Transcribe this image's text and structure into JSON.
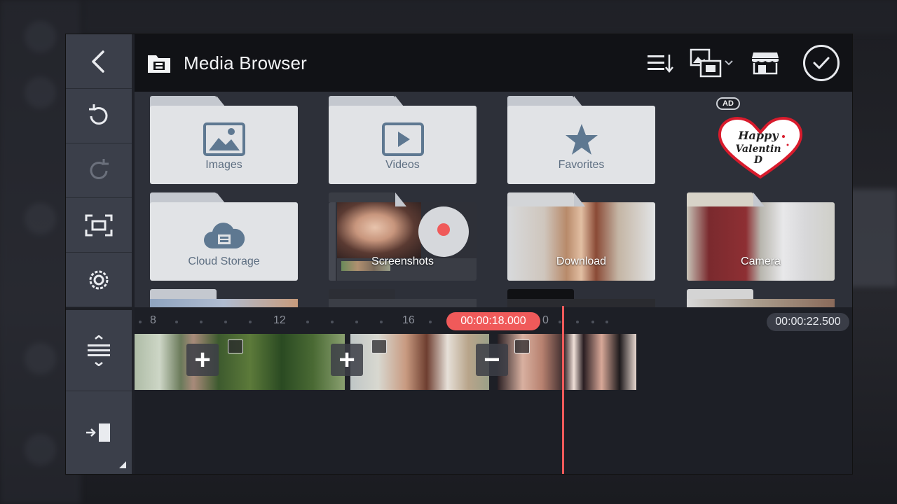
{
  "header": {
    "title": "Media Browser"
  },
  "folders": [
    {
      "label": "Images",
      "icon": "image-icon"
    },
    {
      "label": "Videos",
      "icon": "play-icon"
    },
    {
      "label": "Favorites",
      "icon": "star-icon"
    },
    {
      "label": "Cloud Storage",
      "icon": "cloud-icon"
    },
    {
      "label": "Screenshots",
      "icon": "photo-thumbnail"
    },
    {
      "label": "Download",
      "icon": "photo-thumbnail"
    },
    {
      "label": "Camera",
      "icon": "photo-thumbnail"
    }
  ],
  "ad": {
    "badge": "AD",
    "text_line1": "Happy",
    "text_line2": "Valentin",
    "text_line3": "D"
  },
  "timeline": {
    "ruler_labels": [
      "8",
      "12",
      "16",
      "0"
    ],
    "current_time": "00:00:18.000",
    "total_time": "00:00:22.500"
  },
  "colors": {
    "accent": "#f05a5a",
    "toolbar": "#3b3f4a",
    "header": "#111216",
    "folder": "#e1e3e6",
    "folder_label": "#5e6f82"
  }
}
